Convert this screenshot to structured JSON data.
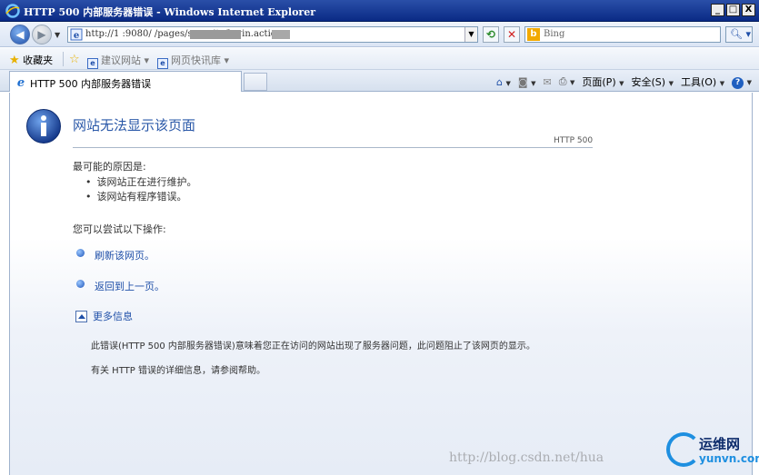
{
  "window": {
    "title": "HTTP 500 内部服务器错误 - Windows Internet Explorer",
    "min_label": "_",
    "max_label": "□",
    "close_label": "X"
  },
  "address": {
    "url": "http://1                    :9080/        /pages/security/login.action",
    "search_placeholder": "Bing"
  },
  "favorites": {
    "label": "收藏夹",
    "suggested_sites": "建议网站 ▾",
    "web_slices": "网页快讯库 ▾"
  },
  "tab": {
    "label": "HTTP 500 内部服务器错误"
  },
  "commands": {
    "page": "页面(P)",
    "safety": "安全(S)",
    "tools": "工具(O)"
  },
  "error": {
    "title": "网站无法显示该页面",
    "code": "HTTP 500",
    "reason_heading": "最可能的原因是:",
    "reasons": [
      "该网站正在进行维护。",
      "该网站有程序错误。"
    ],
    "try_heading": "您可以尝试以下操作:",
    "actions": [
      "刷新该网页。",
      "返回到上一页。"
    ],
    "more_info": "更多信息",
    "detail_1": "此错误(HTTP 500 内部服务器错误)意味着您正在访问的网站出现了服务器问题，此问题阻止了该网页的显示。",
    "detail_2": "有关 HTTP 错误的详细信息，请参阅帮助。"
  },
  "watermark": {
    "url": "http://blog.csdn.net/hua",
    "logo_cn": "运维网",
    "logo_en": "yunvn.com"
  },
  "colors": {
    "titlebar": "#0a2a85",
    "link": "#1f4fa8",
    "title_text": "#2a58a8"
  }
}
